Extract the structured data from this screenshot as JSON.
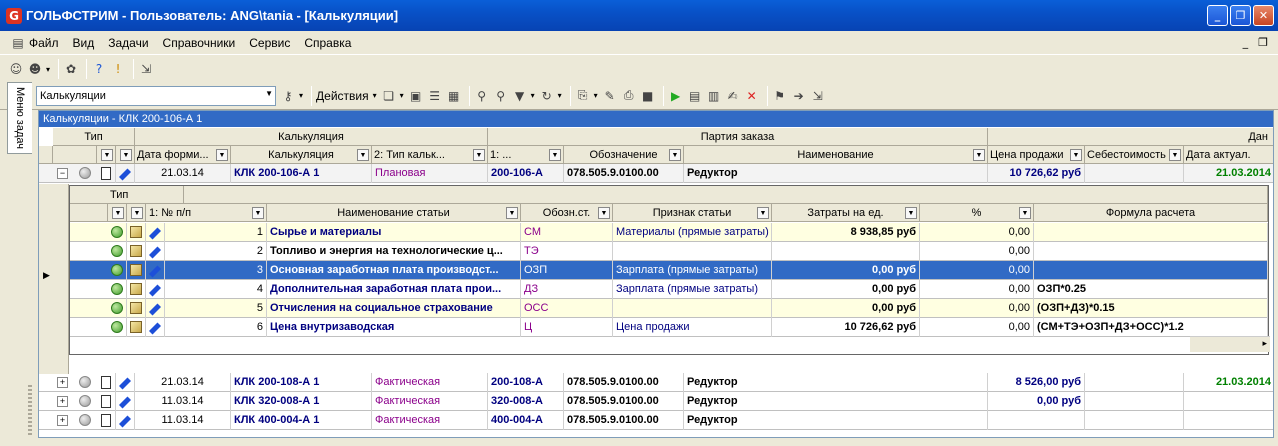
{
  "window": {
    "title": "ГОЛЬФСТРИМ - Пользователь: ANG\\tania - [Калькуляции]"
  },
  "menu": [
    "Файл",
    "Вид",
    "Задачи",
    "Справочники",
    "Сервис",
    "Справка"
  ],
  "toolbar": {
    "combo_value": "Калькуляции",
    "actions_label": "Действия"
  },
  "side_panel": {
    "label": "Меню задач"
  },
  "doc": {
    "title": "Калькуляции - КЛК 200-106-А 1"
  },
  "band_headers": {
    "type": "Тип",
    "calc": "Калькуляция",
    "order_batch": "Партия заказа",
    "data": "Дан"
  },
  "columns": {
    "date": "Дата форми...",
    "calc": "Калькуляция",
    "type2": "2: Тип кальк...",
    "n1": "1: ...",
    "designation": "Обозначение",
    "name": "Наименование",
    "price": "Цена продажи",
    "cost": "Себестоимость",
    "update": "Дата актуал."
  },
  "master_rows": [
    {
      "expander": "−",
      "date": "21.03.14",
      "calc": "КЛК 200-106-А 1",
      "type": "Плановая",
      "n1": "200-106-А",
      "designation": "078.505.9.0100.00",
      "name": "Редуктор",
      "price": "10 726,62 руб",
      "cost": "",
      "update": "21.03.2014"
    },
    {
      "expander": "+",
      "date": "21.03.14",
      "calc": "КЛК 200-108-А 1",
      "type": "Фактическая",
      "n1": "200-108-А",
      "designation": "078.505.9.0100.00",
      "name": "Редуктор",
      "price": "8 526,00 руб",
      "cost": "",
      "update": "21.03.2014"
    },
    {
      "expander": "+",
      "date": "11.03.14",
      "calc": "КЛК 320-008-А 1",
      "type": "Фактическая",
      "n1": "320-008-А",
      "designation": "078.505.9.0100.00",
      "name": "Редуктор",
      "price": "0,00 руб",
      "cost": "",
      "update": ""
    },
    {
      "expander": "+",
      "date": "11.03.14",
      "calc": "КЛК 400-004-А 1",
      "type": "Фактическая",
      "n1": "400-004-А",
      "designation": "078.505.9.0100.00",
      "name": "Редуктор",
      "price": "",
      "cost": "",
      "update": ""
    }
  ],
  "detail": {
    "band_type": "Тип",
    "columns": {
      "num": "1: № п/п",
      "item": "Наименование статьи",
      "code": "Обозн.ст.",
      "sign": "Признак статьи",
      "cost": "Затраты на ед.",
      "pct": "%",
      "formula": "Формула расчета"
    },
    "rows": [
      {
        "num": "1",
        "item": "Сырье и материалы",
        "code": "СМ",
        "sign": "Материалы (прямые затраты)",
        "cost": "8 938,85 руб",
        "pct": "0,00",
        "formula": ""
      },
      {
        "num": "2",
        "item": "Топливо и энергия на технологические ц...",
        "code": "ТЭ",
        "sign": "",
        "cost": "",
        "pct": "0,00",
        "formula": ""
      },
      {
        "num": "3",
        "item": "Основная заработная плата производст...",
        "code": "ОЗП",
        "sign": "Зарплата (прямые затраты)",
        "cost": "0,00 руб",
        "pct": "0,00",
        "formula": ""
      },
      {
        "num": "4",
        "item": "Дополнительная заработная плата прои...",
        "code": "ДЗ",
        "sign": "Зарплата (прямые затраты)",
        "cost": "0,00 руб",
        "pct": "0,00",
        "formula": "ОЗП*0.25"
      },
      {
        "num": "5",
        "item": "Отчисления на социальное страхование",
        "code": "ОСС",
        "sign": "",
        "cost": "0,00 руб",
        "pct": "0,00",
        "formula": "(ОЗП+ДЗ)*0.15"
      },
      {
        "num": "6",
        "item": "Цена внутризаводская",
        "code": "Ц",
        "sign": "Цена продажи",
        "cost": "10 726,62 руб",
        "pct": "0,00",
        "formula": "(СМ+ТЭ+ОЗП+ДЗ+ОСС)*1.2"
      }
    ]
  }
}
